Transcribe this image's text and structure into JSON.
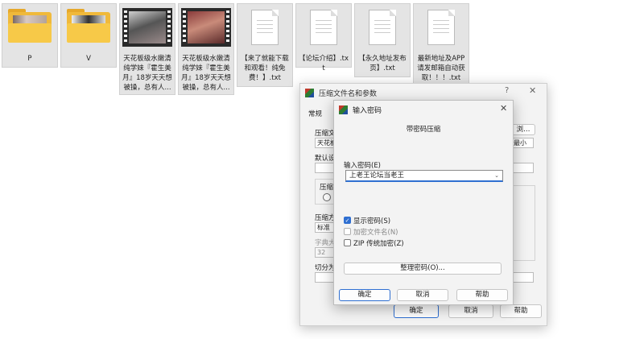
{
  "files": [
    {
      "name": "P",
      "type": "folder"
    },
    {
      "name": "V",
      "type": "folder"
    },
    {
      "name": "天花板级水嫩清纯学妹『霍生美月』18岁天天想被操，总有人...",
      "type": "video"
    },
    {
      "name": "天花板级水嫩清纯学妹『霍生美月』18岁天天想被操，总有人...",
      "type": "video"
    },
    {
      "name": "【来了就能下载和观看！纯免费！】.txt",
      "type": "text"
    },
    {
      "name": "【论坛介绍】.txt",
      "type": "text"
    },
    {
      "name": "【永久地址发布页】.txt",
      "type": "text"
    },
    {
      "name": "最新地址及APP请发邮箱自动获取！！！.txt",
      "type": "text"
    }
  ],
  "archive_dialog": {
    "title": "压缩文件名和参数",
    "help_icon": "?",
    "close_icon": "✕",
    "tab_general": "常规",
    "label_archive_name": "压缩文",
    "archive_name_value": "天花板",
    "browse_label": "浏…",
    "label_default": "默认设",
    "label_format": "压缩",
    "label_method": "压缩方",
    "method_value": "标准",
    "label_dict": "字典大",
    "dict_value": "32",
    "label_split": "切分为",
    "ok": "确定",
    "cancel": "取消",
    "help": "帮助",
    "update_value": "最小"
  },
  "password_dialog": {
    "title": "输入密码",
    "close_icon": "✕",
    "subtitle": "带密码压缩",
    "password_label": "输入密码(E)",
    "password_value": "上老王论坛当老王",
    "show_password": "显示密码(S)",
    "encrypt_names": "加密文件名(N)",
    "zip_legacy": "ZIP 传统加密(Z)",
    "organize_btn": "整理密码(O)...",
    "ok": "确定",
    "cancel": "取消",
    "help": "帮助"
  },
  "colors": {
    "accent": "#2f6fd1",
    "folder": "#f7c948"
  }
}
